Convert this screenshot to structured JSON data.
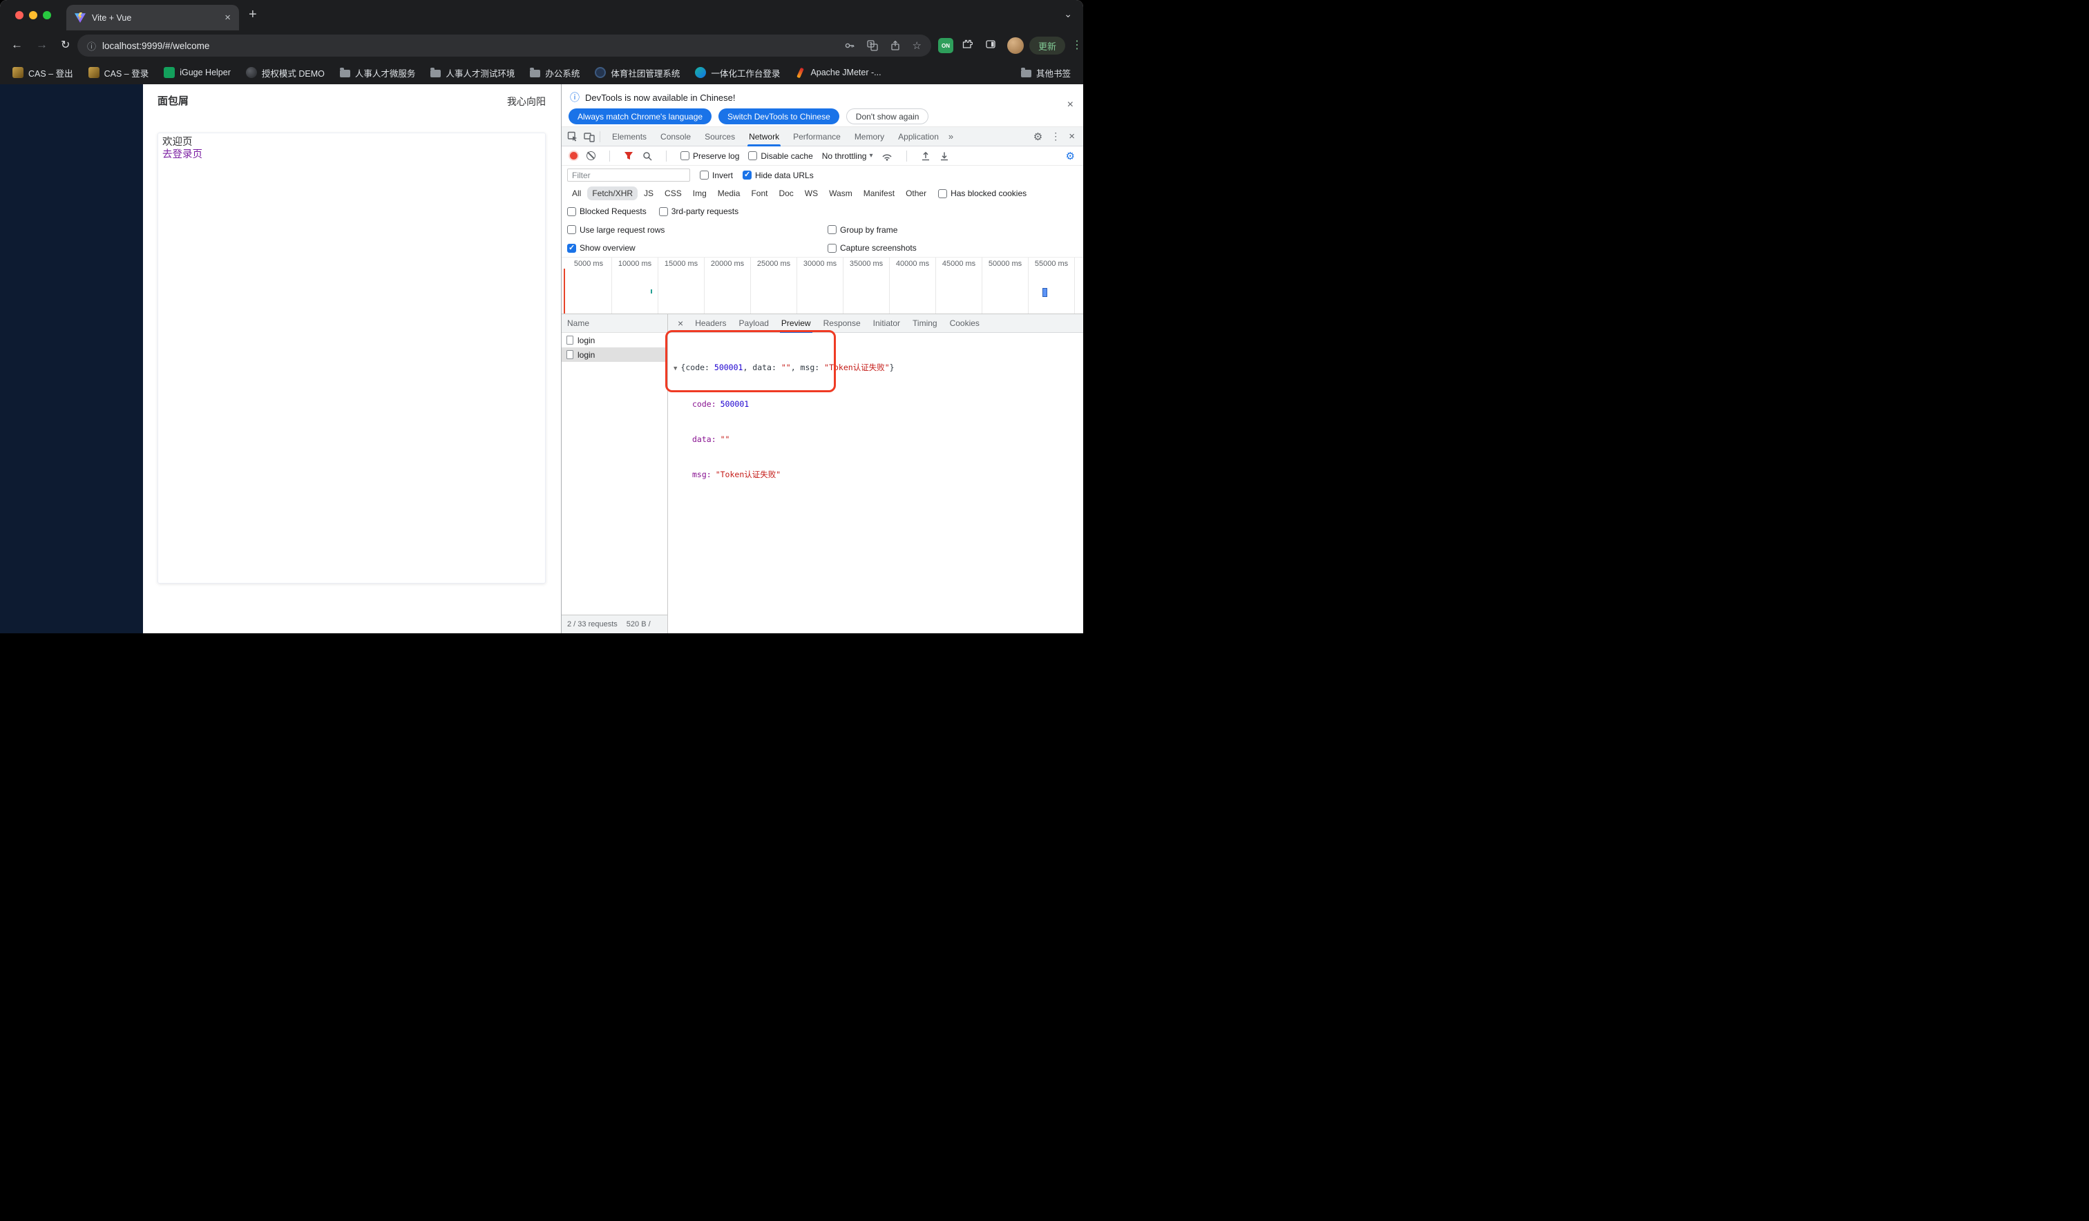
{
  "icons": {
    "close": "×",
    "plus": "+",
    "chevron_down": "⌄",
    "back_arrow": "←",
    "forward_arrow": "→",
    "reload": "↻",
    "info": "ⓘ",
    "star": "☆",
    "kebab": "⋮",
    "gear": "⚙",
    "more_tabs": "»",
    "caret_down": "▾",
    "check": "✓",
    "disclosure_down": "▼"
  },
  "tab_strip": {
    "tab_title": "Vite + Vue"
  },
  "toolbar": {
    "url": "localhost:9999/#/welcome",
    "update_label": "更新",
    "ext_on_badge": "ON"
  },
  "bookmarks": {
    "items": [
      "CAS – 登出",
      "CAS – 登录",
      "iGuge Helper",
      "授权模式 DEMO",
      "人事人才微服务",
      "人事人才测试环境",
      "办公系统",
      "体育社团管理系统",
      "一体化工作台登录",
      "Apache JMeter -..."
    ],
    "other": "其他书签"
  },
  "page": {
    "breadcrumb": "面包屑",
    "username": "我心向阳",
    "welcome_text": "欢迎页",
    "login_link": "去登录页"
  },
  "devtools": {
    "infobar": {
      "message": "DevTools is now available in Chinese!",
      "btn_match": "Always match Chrome's language",
      "btn_switch": "Switch DevTools to Chinese",
      "btn_dismiss": "Don't show again"
    },
    "tabs": [
      "Elements",
      "Console",
      "Sources",
      "Network",
      "Performance",
      "Memory",
      "Application"
    ],
    "net_toolbar": {
      "preserve_log": "Preserve log",
      "disable_cache": "Disable cache",
      "throttling": "No throttling"
    },
    "filters": {
      "placeholder": "Filter",
      "invert": "Invert",
      "hide_data_urls": "Hide data URLs",
      "chips": [
        "All",
        "Fetch/XHR",
        "JS",
        "CSS",
        "Img",
        "Media",
        "Font",
        "Doc",
        "WS",
        "Wasm",
        "Manifest",
        "Other"
      ],
      "has_blocked_cookies": "Has blocked cookies",
      "blocked_requests": "Blocked Requests",
      "third_party": "3rd-party requests"
    },
    "options": {
      "use_large_rows": "Use large request rows",
      "group_by_frame": "Group by frame",
      "show_overview": "Show overview",
      "capture_screenshots": "Capture screenshots"
    },
    "timeline_ticks": [
      "5000 ms",
      "10000 ms",
      "15000 ms",
      "20000 ms",
      "25000 ms",
      "30000 ms",
      "35000 ms",
      "40000 ms",
      "45000 ms",
      "50000 ms",
      "55000 ms"
    ],
    "requests": {
      "header": "Name",
      "rows": [
        "login",
        "login"
      ]
    },
    "detail_tabs": [
      "Headers",
      "Payload",
      "Preview",
      "Response",
      "Initiator",
      "Timing",
      "Cookies"
    ],
    "preview": {
      "summary_open": "{code: ",
      "summary_num": "500001",
      "summary_mid1": ", data: ",
      "summary_str1": "\"\"",
      "summary_mid2": ", msg: ",
      "summary_str2": "\"Token认证失败\"",
      "summary_close": "}",
      "rows": [
        {
          "label": "code:",
          "value": "500001"
        },
        {
          "label": "data:",
          "value": "\"\""
        },
        {
          "label": "msg:",
          "value": "\"Token认证失败\""
        }
      ]
    },
    "status": {
      "requests": "2 / 33 requests",
      "size": "520 B /"
    }
  }
}
